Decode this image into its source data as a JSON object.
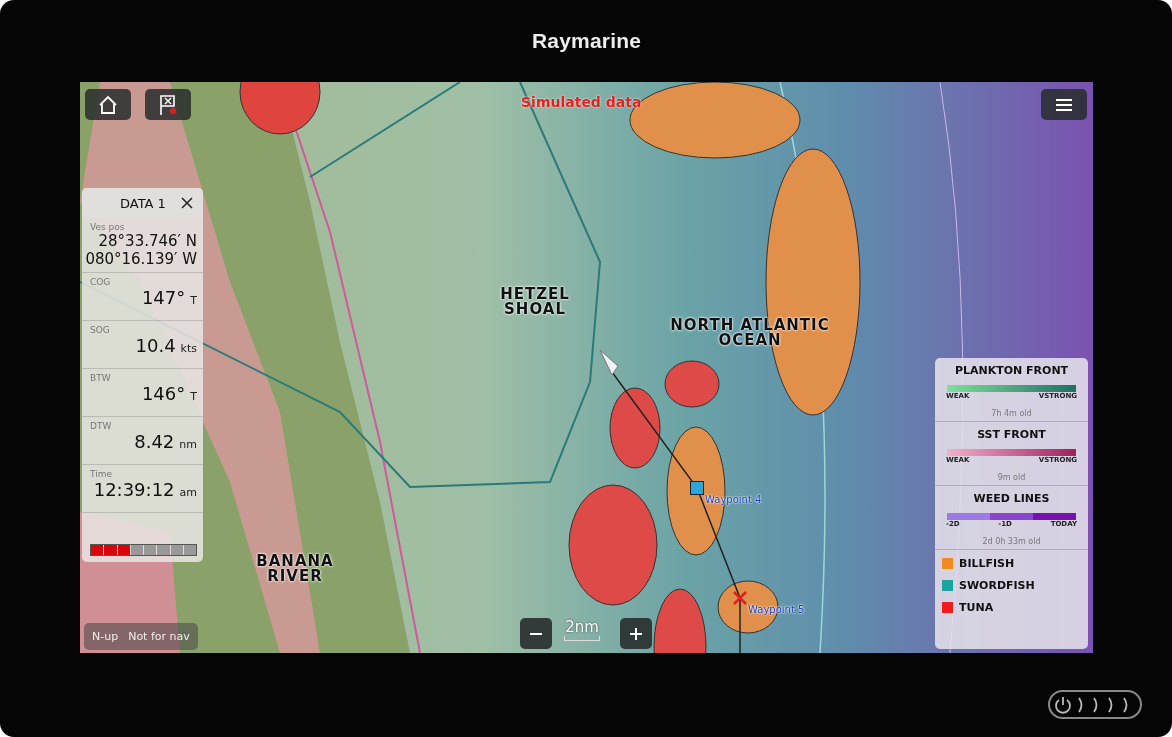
{
  "device": {
    "brand": "Raymarine"
  },
  "map": {
    "notice": "Simulated data",
    "places": [
      {
        "label": "HETZEL SHOAL",
        "kind": "shoal"
      },
      {
        "label": "NORTH ATLANTIC OCEAN",
        "kind": "ocean"
      },
      {
        "label": "BANANA RIVER",
        "kind": "river"
      }
    ],
    "waypoints": [
      {
        "label": "Waypoint 4",
        "kind": "square"
      },
      {
        "label": "Waypoint 5",
        "kind": "cross"
      }
    ],
    "scale": "2nm",
    "orientation": "N-up",
    "disclaimer": "Not for nav"
  },
  "data_panel": {
    "title": "DATA 1",
    "items": [
      {
        "label": "Ves pos",
        "values": [
          "28°33.746′ N",
          "080°16.139′ W"
        ]
      },
      {
        "label": "COG",
        "values": [
          "147°"
        ],
        "unit": "T"
      },
      {
        "label": "SOG",
        "values": [
          "10.4"
        ],
        "unit": "kts"
      },
      {
        "label": "BTW",
        "values": [
          "146°"
        ],
        "unit": "T"
      },
      {
        "label": "DTW",
        "values": [
          "8.42"
        ],
        "unit": "nm"
      },
      {
        "label": "Time",
        "values": [
          "12:39:12"
        ],
        "unit": "am"
      }
    ],
    "meter": {
      "level": 0.375
    }
  },
  "legend": {
    "layers": [
      {
        "title": "PLANKTON FRONT",
        "kind": "plankton",
        "scale": [
          "WEAK",
          "VSTRONG"
        ],
        "age": "7h  4m old"
      },
      {
        "title": "SST FRONT",
        "kind": "sst",
        "scale": [
          "WEAK",
          "VSTRONG"
        ],
        "age": "9m old"
      },
      {
        "title": "WEED LINES",
        "kind": "weed",
        "scale": [
          "-2D",
          "-1D",
          "TODAY"
        ],
        "age": "2d  0h 33m old"
      }
    ],
    "species": [
      {
        "label": "BILLFISH",
        "color": "#f28a1e"
      },
      {
        "label": "SWORDFISH",
        "color": "#1aa3a0"
      },
      {
        "label": "TUNA",
        "color": "#ee1c1c"
      }
    ]
  }
}
